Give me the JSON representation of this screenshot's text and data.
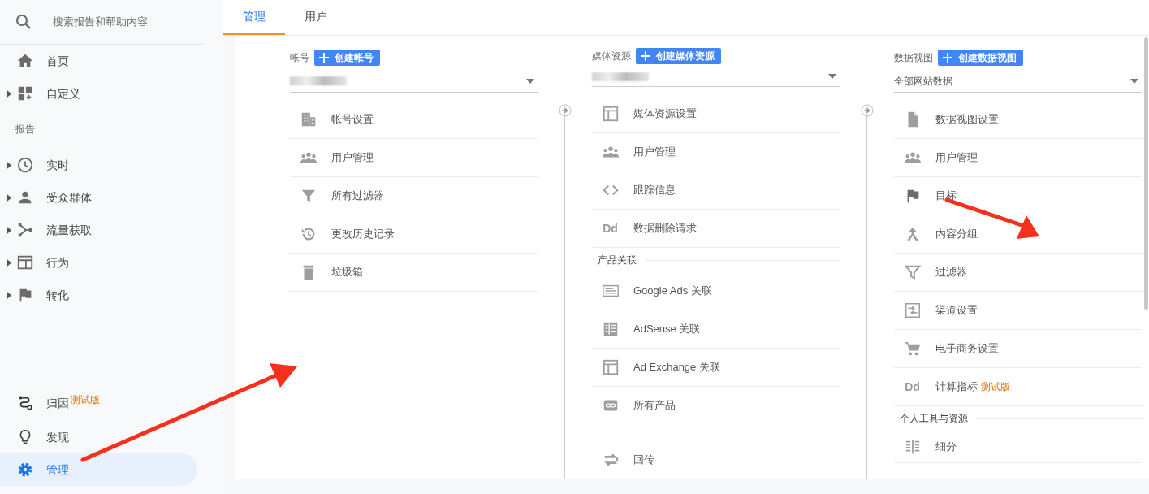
{
  "sidebar": {
    "search": {
      "placeholder": "搜索报告和帮助内容"
    },
    "items": [
      {
        "kind": "item",
        "label": "首页",
        "expandable": false,
        "selected": false
      },
      {
        "kind": "item",
        "label": "自定义",
        "expandable": true,
        "selected": false
      },
      {
        "kind": "heading",
        "label": "报告"
      },
      {
        "kind": "item",
        "label": "实时",
        "expandable": true,
        "selected": false
      },
      {
        "kind": "item",
        "label": "受众群体",
        "expandable": true,
        "selected": false
      },
      {
        "kind": "item",
        "label": "流量获取",
        "expandable": true,
        "selected": false
      },
      {
        "kind": "item",
        "label": "行为",
        "expandable": true,
        "selected": false
      },
      {
        "kind": "item",
        "label": "转化",
        "expandable": true,
        "selected": false
      }
    ],
    "bottom_items": [
      {
        "label": "归因",
        "badge": "测试版",
        "selected": false
      },
      {
        "label": "发现",
        "selected": false
      },
      {
        "label": "管理",
        "selected": true
      }
    ]
  },
  "tabs": [
    {
      "label": "管理",
      "selected": true
    },
    {
      "label": "用户",
      "selected": false
    }
  ],
  "columns": [
    {
      "label": "帐号",
      "create_button": "创建帐号",
      "rows": [
        {
          "kind": "item",
          "label": "帐号设置"
        },
        {
          "kind": "item",
          "label": "用户管理"
        },
        {
          "kind": "item",
          "label": "所有过滤器"
        },
        {
          "kind": "item",
          "label": "更改历史记录"
        },
        {
          "kind": "item",
          "label": "垃圾箱"
        }
      ]
    },
    {
      "label": "媒体资源",
      "create_button": "创建媒体资源",
      "rows": [
        {
          "kind": "item",
          "label": "媒体资源设置"
        },
        {
          "kind": "item",
          "label": "用户管理"
        },
        {
          "kind": "item",
          "label": "跟踪信息"
        },
        {
          "kind": "item",
          "label": "数据删除请求",
          "icon_text": "Dd"
        },
        {
          "kind": "heading",
          "label": "产品关联"
        },
        {
          "kind": "item",
          "label": "Google Ads 关联"
        },
        {
          "kind": "item",
          "label": "AdSense 关联"
        },
        {
          "kind": "item",
          "label": "Ad Exchange 关联"
        },
        {
          "kind": "item",
          "label": "所有产品",
          "border": false
        },
        {
          "kind": "item",
          "label": "回传",
          "gap_before": true,
          "border": false
        }
      ]
    },
    {
      "label": "数据视图",
      "create_button": "创建数据视图",
      "selector_value": "全部网站数据",
      "rows": [
        {
          "kind": "item",
          "label": "数据视图设置"
        },
        {
          "kind": "item",
          "label": "用户管理"
        },
        {
          "kind": "item",
          "label": "目标"
        },
        {
          "kind": "item",
          "label": "内容分组"
        },
        {
          "kind": "item",
          "label": "过滤器"
        },
        {
          "kind": "item",
          "label": "渠道设置"
        },
        {
          "kind": "item",
          "label": "电子商务设置"
        },
        {
          "kind": "item",
          "label": "计算指标",
          "icon_text": "Dd",
          "badge": "测试版"
        },
        {
          "kind": "heading",
          "label": "个人工具与资源"
        },
        {
          "kind": "item",
          "label": "细分",
          "compact": true
        }
      ]
    }
  ]
}
